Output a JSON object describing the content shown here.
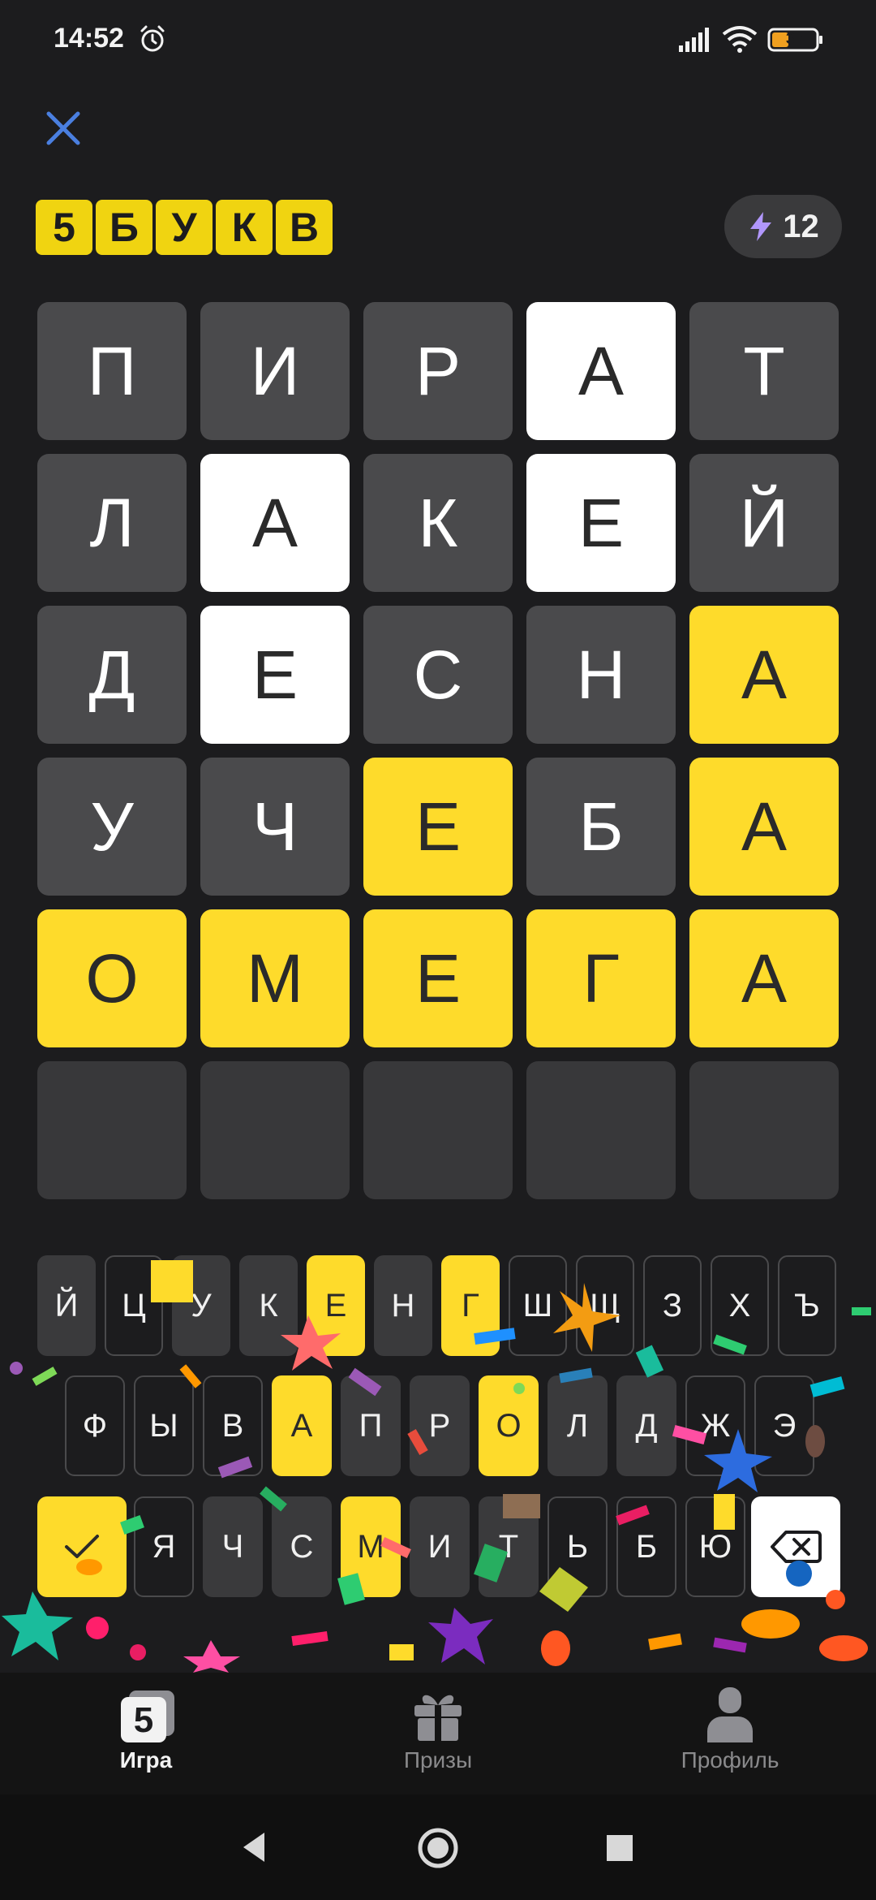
{
  "status_bar": {
    "time": "14:52",
    "battery": "37"
  },
  "logo": {
    "letters": [
      "5",
      "Б",
      "У",
      "К",
      "В"
    ]
  },
  "energy": {
    "count": "12"
  },
  "board": {
    "rows": [
      [
        {
          "letter": "П",
          "state": "absent"
        },
        {
          "letter": "И",
          "state": "absent"
        },
        {
          "letter": "Р",
          "state": "absent"
        },
        {
          "letter": "А",
          "state": "present"
        },
        {
          "letter": "Т",
          "state": "absent"
        }
      ],
      [
        {
          "letter": "Л",
          "state": "absent"
        },
        {
          "letter": "А",
          "state": "present"
        },
        {
          "letter": "К",
          "state": "absent"
        },
        {
          "letter": "Е",
          "state": "present"
        },
        {
          "letter": "Й",
          "state": "absent"
        }
      ],
      [
        {
          "letter": "Д",
          "state": "absent"
        },
        {
          "letter": "Е",
          "state": "present"
        },
        {
          "letter": "С",
          "state": "absent"
        },
        {
          "letter": "Н",
          "state": "absent"
        },
        {
          "letter": "А",
          "state": "correct"
        }
      ],
      [
        {
          "letter": "У",
          "state": "absent"
        },
        {
          "letter": "Ч",
          "state": "absent"
        },
        {
          "letter": "Е",
          "state": "correct"
        },
        {
          "letter": "Б",
          "state": "absent"
        },
        {
          "letter": "А",
          "state": "correct"
        }
      ],
      [
        {
          "letter": "О",
          "state": "correct"
        },
        {
          "letter": "М",
          "state": "correct"
        },
        {
          "letter": "Е",
          "state": "correct"
        },
        {
          "letter": "Г",
          "state": "correct"
        },
        {
          "letter": "А",
          "state": "correct"
        }
      ],
      [
        {
          "letter": "",
          "state": "empty"
        },
        {
          "letter": "",
          "state": "empty"
        },
        {
          "letter": "",
          "state": "empty"
        },
        {
          "letter": "",
          "state": "empty"
        },
        {
          "letter": "",
          "state": "empty"
        }
      ]
    ]
  },
  "keyboard": {
    "row1": [
      {
        "label": "Й",
        "state": "unused"
      },
      {
        "label": "Ц",
        "state": "absent"
      },
      {
        "label": "У",
        "state": "unused"
      },
      {
        "label": "К",
        "state": "unused"
      },
      {
        "label": "Е",
        "state": "correct"
      },
      {
        "label": "Н",
        "state": "unused"
      },
      {
        "label": "Г",
        "state": "correct"
      },
      {
        "label": "Ш",
        "state": "absent"
      },
      {
        "label": "Щ",
        "state": "absent"
      },
      {
        "label": "З",
        "state": "absent"
      },
      {
        "label": "Х",
        "state": "absent"
      },
      {
        "label": "Ъ",
        "state": "absent"
      }
    ],
    "row2": [
      {
        "label": "Ф",
        "state": "absent"
      },
      {
        "label": "Ы",
        "state": "absent"
      },
      {
        "label": "В",
        "state": "absent"
      },
      {
        "label": "А",
        "state": "correct"
      },
      {
        "label": "П",
        "state": "unused"
      },
      {
        "label": "Р",
        "state": "unused"
      },
      {
        "label": "О",
        "state": "correct"
      },
      {
        "label": "Л",
        "state": "unused"
      },
      {
        "label": "Д",
        "state": "unused"
      },
      {
        "label": "Ж",
        "state": "absent"
      },
      {
        "label": "Э",
        "state": "absent"
      }
    ],
    "row3": [
      {
        "label": "Я",
        "state": "absent"
      },
      {
        "label": "Ч",
        "state": "unused"
      },
      {
        "label": "С",
        "state": "unused"
      },
      {
        "label": "М",
        "state": "correct"
      },
      {
        "label": "И",
        "state": "unused"
      },
      {
        "label": "Т",
        "state": "unused"
      },
      {
        "label": "Ь",
        "state": "absent"
      },
      {
        "label": "Б",
        "state": "absent"
      },
      {
        "label": "Ю",
        "state": "absent"
      }
    ],
    "enter_icon": "check-icon",
    "backspace_icon": "backspace-icon"
  },
  "bottom_nav": {
    "items": [
      {
        "label": "Игра",
        "icon": "game-icon",
        "active": true,
        "icon_text": "5"
      },
      {
        "label": "Призы",
        "icon": "gift-icon",
        "active": false
      },
      {
        "label": "Профиль",
        "icon": "profile-icon",
        "active": false
      }
    ]
  },
  "colors": {
    "background": "#1c1c1e",
    "correct": "#fedb2b",
    "present": "#ffffff",
    "absent": "#4a4a4c",
    "accent_close": "#4a7fe0",
    "energy_bolt": "#b197fc"
  }
}
